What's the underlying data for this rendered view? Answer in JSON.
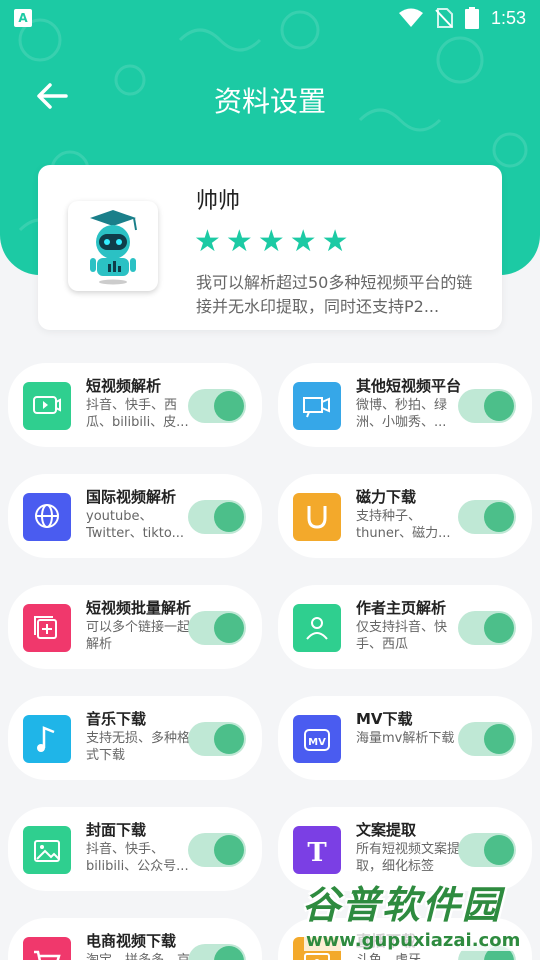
{
  "status_bar": {
    "time": "1:53",
    "app_badge": "A"
  },
  "header": {
    "title": "资料设置"
  },
  "profile": {
    "name": "帅帅",
    "rating": 5,
    "stars": [
      "★",
      "★",
      "★",
      "★",
      "★"
    ],
    "description": "我可以解析超过50多种短视频平台的链接并无水印提取，同时还支持P2..."
  },
  "accent_color": "#1ccaa4",
  "features": [
    {
      "title": "短视频解析",
      "subtitle": "抖音、快手、西瓜、bilibili、皮...",
      "icon": "video-play-icon",
      "color": "#2fcf8f",
      "enabled": true
    },
    {
      "title": "其他短视频平台",
      "subtitle": "微博、秒拍、绿洲、小咖秀、...",
      "icon": "camera-icon",
      "color": "#36a7e8",
      "enabled": true
    },
    {
      "title": "国际视频解析",
      "subtitle": "youtube、Twitter、tikto...",
      "icon": "globe-icon",
      "color": "#4a5cf0",
      "enabled": true
    },
    {
      "title": "磁力下载",
      "subtitle": "支持种子、thuner、磁力...",
      "icon": "magnet-icon",
      "color": "#f3a92b",
      "enabled": true
    },
    {
      "title": "短视频批量解析",
      "subtitle": "可以多个链接一起解析",
      "icon": "batch-icon",
      "color": "#f0386c",
      "enabled": true
    },
    {
      "title": "作者主页解析",
      "subtitle": "仅支持抖音、快手、西瓜",
      "icon": "user-icon",
      "color": "#2fcf8f",
      "enabled": true
    },
    {
      "title": "音乐下载",
      "subtitle": "支持无损、多种格式下载",
      "icon": "music-icon",
      "color": "#1fb5e8",
      "enabled": true
    },
    {
      "title": "MV下载",
      "subtitle": "海量mv解析下载",
      "icon": "mv-icon",
      "color": "#4a5cf0",
      "enabled": true
    },
    {
      "title": "封面下载",
      "subtitle": "抖音、快手、bilibili、公众号...",
      "icon": "image-icon",
      "color": "#2fcf8f",
      "enabled": true
    },
    {
      "title": "文案提取",
      "subtitle": "所有短视频文案提取，细化标签",
      "icon": "text-icon",
      "color": "#7b3fe4",
      "enabled": true
    },
    {
      "title": "电商视频下载",
      "subtitle": "淘宝、拼多多、京东、闲鱼...",
      "icon": "cart-icon",
      "color": "#f0386c",
      "enabled": true
    },
    {
      "title": "直播下载",
      "subtitle": "斗鱼、虎牙...",
      "icon": "live-icon",
      "color": "#f3a92b",
      "enabled": true
    }
  ],
  "watermark": {
    "title": "谷普软件园",
    "url": "www.gupuxiazai.com"
  }
}
